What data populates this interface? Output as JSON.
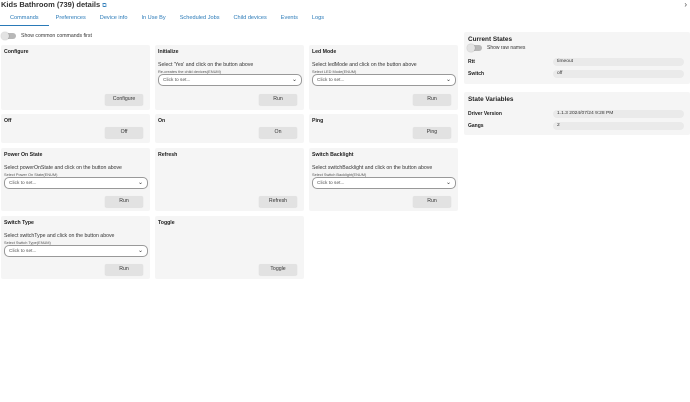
{
  "header": {
    "title": "Kids Bathroom (739) details",
    "external_icon": "external-link-icon",
    "collapse_icon": "chevron-right-icon"
  },
  "tabs": [
    {
      "label": "Commands",
      "active": true
    },
    {
      "label": "Preferences"
    },
    {
      "label": "Device info"
    },
    {
      "label": "In Use By"
    },
    {
      "label": "Scheduled Jobs"
    },
    {
      "label": "Child devices"
    },
    {
      "label": "Events"
    },
    {
      "label": "Logs"
    }
  ],
  "commands": {
    "show_common_label": "Show common commands first",
    "cards": [
      {
        "title": "Configure",
        "button": "Configure"
      },
      {
        "title": "Initialize",
        "desc": "Select 'Yes' and click on the button above",
        "hint": "Re-creates the child devices(ENUM)",
        "placeholder": "Click to set...",
        "button": "Run"
      },
      {
        "title": "Led Mode",
        "desc": "Select ledMode and click on the button above",
        "hint": "Select LED Mode(ENUM)",
        "placeholder": "Click to set...",
        "button": "Run"
      },
      {
        "title": "Off",
        "button": "Off"
      },
      {
        "title": "On",
        "button": "On"
      },
      {
        "title": "Ping",
        "button": "Ping"
      },
      {
        "title": "Power On State",
        "desc": "Select powerOnState and click on the button above",
        "hint": "Select Power On State(ENUM)",
        "placeholder": "Click to set...",
        "button": "Run"
      },
      {
        "title": "Refresh",
        "button": "Refresh"
      },
      {
        "title": "Switch Backlight",
        "desc": "Select switchBacklight and click on the button above",
        "hint": "Select Switch Backlight(ENUM)",
        "placeholder": "Click to set...",
        "button": "Run"
      },
      {
        "title": "Switch Type",
        "desc": "Select switchType and click on the button above",
        "hint": "Select Switch Type(ENUM)",
        "placeholder": "Click to set...",
        "button": "Run"
      },
      {
        "title": "Toggle",
        "button": "Toggle"
      }
    ]
  },
  "current_states": {
    "title": "Current States",
    "raw_names_label": "Show raw names",
    "rows": [
      {
        "key": "Rtt",
        "value": "timeout"
      },
      {
        "key": "Switch",
        "value": "off"
      }
    ]
  },
  "state_variables": {
    "title": "State Variables",
    "rows": [
      {
        "key": "Driver Version",
        "value": "1.1.3 2024/07/24 9:28 PM"
      },
      {
        "key": "Gangs",
        "value": "2"
      }
    ]
  }
}
